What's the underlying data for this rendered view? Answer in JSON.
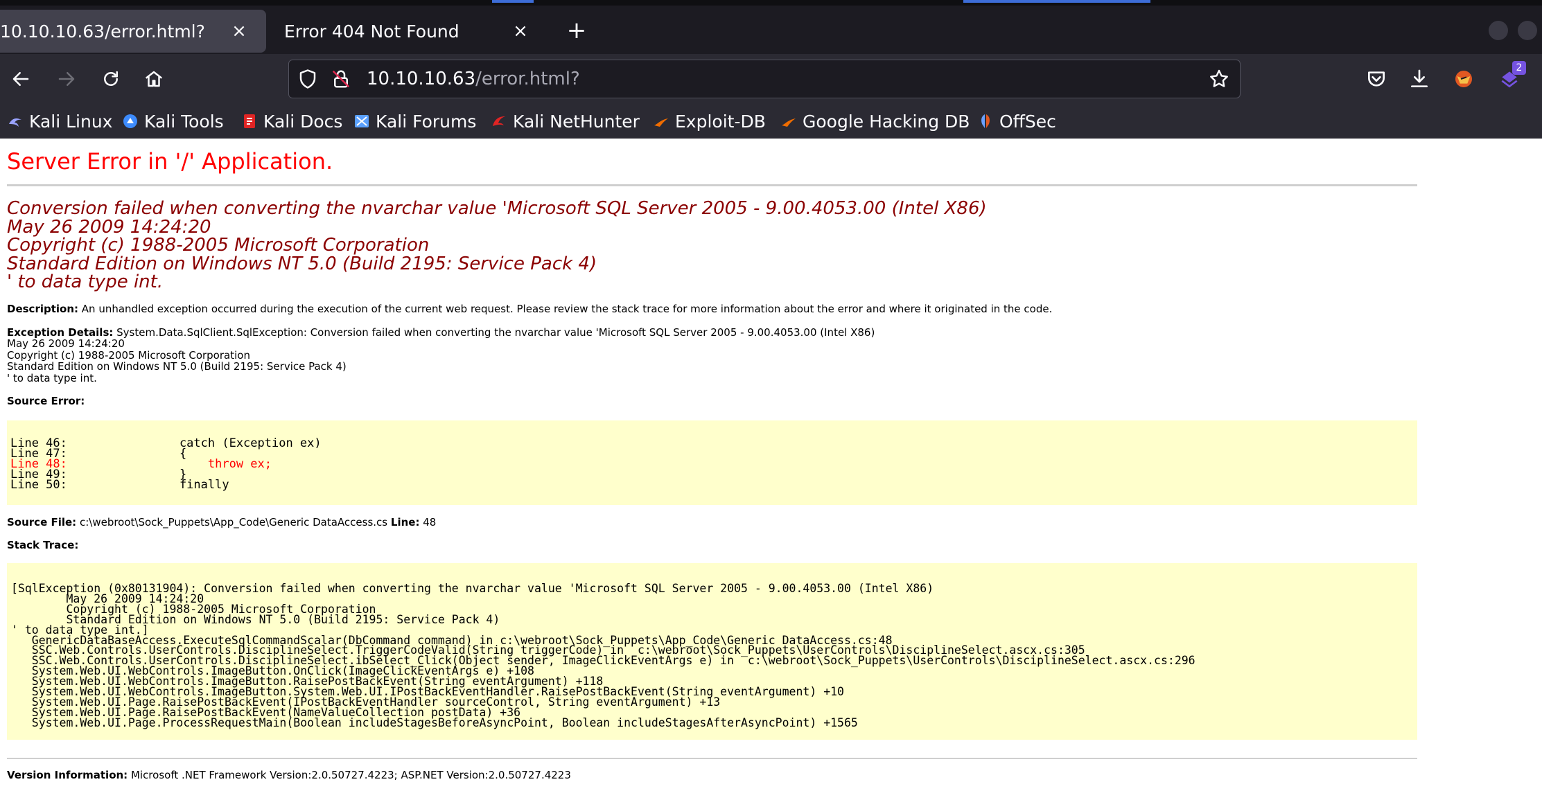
{
  "browser": {
    "tabs": [
      {
        "title": "10.10.10.63/error.html?",
        "active": true
      },
      {
        "title": "Error 404 Not Found",
        "active": false
      }
    ],
    "close_glyph": "×",
    "new_tab_glyph": "+",
    "address": {
      "host": "10.10.10.63",
      "path": "/error.html?"
    },
    "downloads_badge": "2",
    "bookmarks": [
      {
        "label": "Kali Linux",
        "icon": "kali-dragon-icon",
        "color": "#9aa3ff"
      },
      {
        "label": "Kali Tools",
        "icon": "kali-tools-icon",
        "color": "#3d8bfd"
      },
      {
        "label": "Kali Docs",
        "icon": "kali-docs-icon",
        "color": "#e02424"
      },
      {
        "label": "Kali Forums",
        "icon": "kali-forums-icon",
        "color": "#5aa0ff"
      },
      {
        "label": "Kali NetHunter",
        "icon": "kali-nethunter-icon",
        "color": "#e02424"
      },
      {
        "label": "Exploit-DB",
        "icon": "exploit-db-icon",
        "color": "#ef6c00"
      },
      {
        "label": "Google Hacking DB",
        "icon": "ghdb-icon",
        "color": "#ef6c00"
      },
      {
        "label": "OffSec",
        "icon": "offsec-icon",
        "color": "#6aa0ff"
      }
    ]
  },
  "error_page": {
    "title": "Server Error in '/' Application.",
    "heading_lines": [
      "Conversion failed when converting the nvarchar value 'Microsoft SQL Server 2005 - 9.00.4053.00 (Intel X86)",
      "May 26 2009 14:24:20",
      "Copyright (c) 1988-2005 Microsoft Corporation",
      "Standard Edition on Windows NT 5.0 (Build 2195: Service Pack 4)",
      "' to data type int."
    ],
    "description_label": "Description:",
    "description_text": "An unhandled exception occurred during the execution of the current web request. Please review the stack trace for more information about the error and where it originated in the code.",
    "exception_label": "Exception Details:",
    "exception_lines": [
      "System.Data.SqlClient.SqlException: Conversion failed when converting the nvarchar value 'Microsoft SQL Server 2005 - 9.00.4053.00 (Intel X86)",
      "May 26 2009 14:24:20",
      "Copyright (c) 1988-2005 Microsoft Corporation",
      "Standard Edition on Windows NT 5.0 (Build 2195: Service Pack 4)",
      "' to data type int."
    ],
    "source_error_label": "Source Error:",
    "source_lines": [
      {
        "num": "Line 46:",
        "code": "    catch (Exception ex)",
        "highlight": false
      },
      {
        "num": "Line 47:",
        "code": "    {",
        "highlight": false
      },
      {
        "num": "Line 48:",
        "code": "        throw ex;",
        "highlight": true
      },
      {
        "num": "Line 49:",
        "code": "    }",
        "highlight": false
      },
      {
        "num": "Line 50:",
        "code": "    finally",
        "highlight": false
      }
    ],
    "source_file_label": "Source File:",
    "source_file_path": "c:\\webroot\\Sock_Puppets\\App_Code\\Generic DataAccess.cs",
    "line_label": "Line:",
    "line_number": "48",
    "stack_trace_label": "Stack Trace:",
    "stack_lines": [
      "[SqlException (0x80131904): Conversion failed when converting the nvarchar value 'Microsoft SQL Server 2005 - 9.00.4053.00 (Intel X86)",
      "        May 26 2009 14:24:20",
      "        Copyright (c) 1988-2005 Microsoft Corporation",
      "        Standard Edition on Windows NT 5.0 (Build 2195: Service Pack 4)",
      "' to data type int.]",
      "   GenericDataBaseAccess.ExecuteSqlCommandScalar(DbCommand command) in c:\\webroot\\Sock_Puppets\\App_Code\\Generic DataAccess.cs:48",
      "   SSC.Web.Controls.UserControls.DisciplineSelect.TriggerCodeValid(String triggerCode) in  c:\\webroot\\Sock_Puppets\\UserControls\\DisciplineSelect.ascx.cs:305",
      "   SSC.Web.Controls.UserControls.DisciplineSelect.ibSelect_Click(Object sender, ImageClickEventArgs e) in  c:\\webroot\\Sock_Puppets\\UserControls\\DisciplineSelect.ascx.cs:296",
      "   System.Web.UI.WebControls.ImageButton.OnClick(ImageClickEventArgs e) +108",
      "   System.Web.UI.WebControls.ImageButton.RaisePostBackEvent(String eventArgument) +118",
      "   System.Web.UI.WebControls.ImageButton.System.Web.UI.IPostBackEventHandler.RaisePostBackEvent(String eventArgument) +10",
      "   System.Web.UI.Page.RaisePostBackEvent(IPostBackEventHandler sourceControl, String eventArgument) +13",
      "   System.Web.UI.Page.RaisePostBackEvent(NameValueCollection postData) +36",
      "   System.Web.UI.Page.ProcessRequestMain(Boolean includeStagesBeforeAsyncPoint, Boolean includeStagesAfterAsyncPoint) +1565"
    ],
    "version_label": "Version Information:",
    "version_text": "Microsoft .NET Framework Version:2.0.50727.4223; ASP.NET Version:2.0.50727.4223"
  }
}
